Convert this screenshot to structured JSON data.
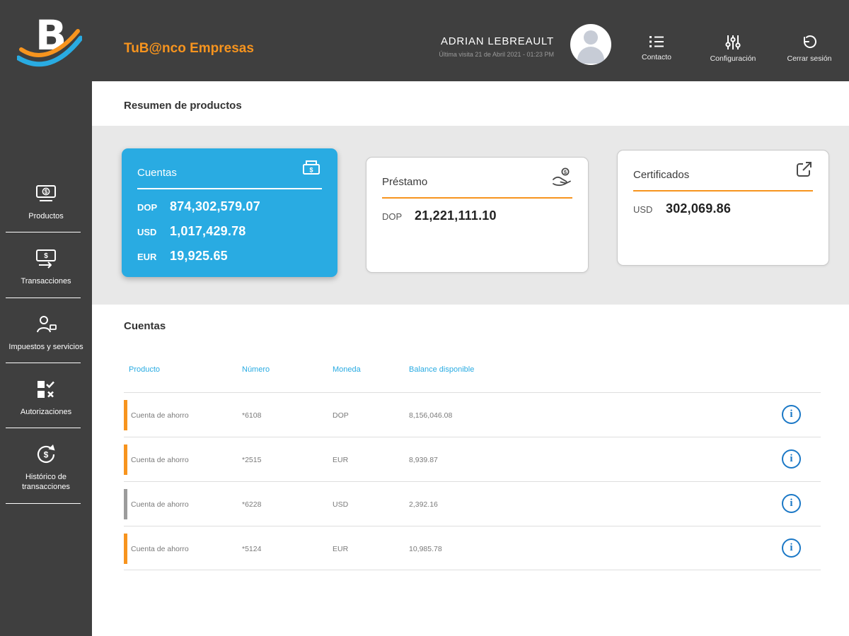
{
  "colors": {
    "orange": "#f7941e",
    "gray": "#9c9c9c",
    "blue": "#29abe2",
    "info_blue": "#1b78c6",
    "dark": "#3f3f3f"
  },
  "header": {
    "brand": "TuB@nco Empresas",
    "user": {
      "name": "ADRIAN LEBREAULT",
      "last_visit": "Última visita 21 de Abril 2021 - 01:23 PM"
    },
    "actions": [
      {
        "label": "Contacto",
        "icon": "contact-list-icon"
      },
      {
        "label": "Configuración",
        "icon": "settings-sliders-icon"
      },
      {
        "label": "Cerrar sesión",
        "icon": "logout-icon"
      }
    ]
  },
  "sidebar": {
    "items": [
      {
        "label": "Productos",
        "icon": "banknote-icon"
      },
      {
        "label": "Transacciones",
        "icon": "transfer-icon"
      },
      {
        "label": "Impuestos y servicios",
        "icon": "person-service-icon"
      },
      {
        "label": "Autorizaciones",
        "icon": "checklist-icon"
      },
      {
        "label": "Histórico de transacciones",
        "icon": "history-icon"
      }
    ]
  },
  "summary": {
    "title": "Resumen de productos",
    "cards": [
      {
        "title": "Cuentas",
        "icon": "cash-box-icon",
        "rows": [
          {
            "currency": "DOP",
            "amount": "874,302,579.07"
          },
          {
            "currency": "USD",
            "amount": "1,017,429.78"
          },
          {
            "currency": "EUR",
            "amount": "19,925.65"
          }
        ]
      },
      {
        "title": "Préstamo",
        "icon": "hand-coin-icon",
        "rows": [
          {
            "currency": "DOP",
            "amount": "21,221,111.10"
          }
        ]
      },
      {
        "title": "Certificados",
        "icon": "external-link-icon",
        "rows": [
          {
            "currency": "USD",
            "amount": "302,069.86"
          }
        ]
      }
    ]
  },
  "accounts": {
    "title": "Cuentas",
    "columns": [
      "Producto",
      "Número",
      "Moneda",
      "Balance disponible"
    ],
    "rows": [
      {
        "product": "Cuenta de ahorro",
        "number": "*6108",
        "currency": "DOP",
        "balance": "8,156,046.08",
        "bar": "orange"
      },
      {
        "product": "Cuenta de ahorro",
        "number": "*2515",
        "currency": "EUR",
        "balance": "8,939.87",
        "bar": "orange"
      },
      {
        "product": "Cuenta de ahorro",
        "number": "*6228",
        "currency": "USD",
        "balance": "2,392.16",
        "bar": "gray"
      },
      {
        "product": "Cuenta de ahorro",
        "number": "*5124",
        "currency": "EUR",
        "balance": "10,985.78",
        "bar": "orange"
      }
    ]
  }
}
